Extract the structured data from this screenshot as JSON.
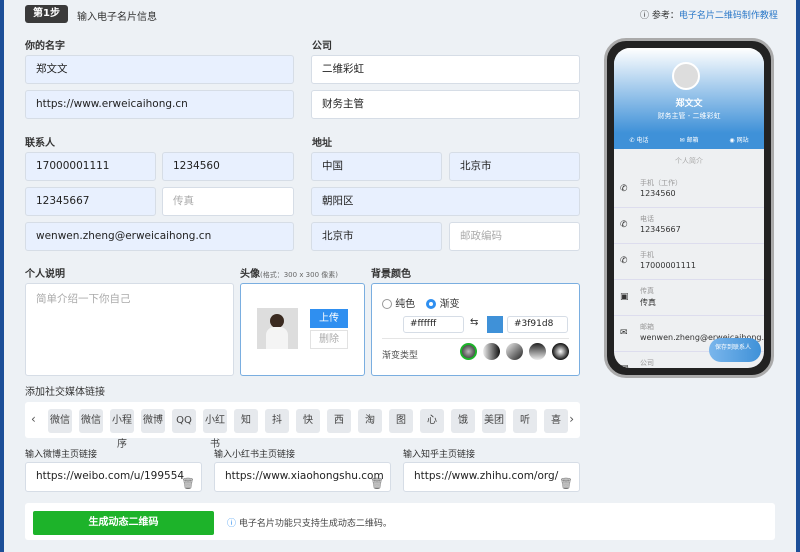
{
  "header": {
    "step": "第1步",
    "title": "输入电子名片信息",
    "ref_label": "参考：",
    "ref_link": "电子名片二维码制作教程"
  },
  "name": {
    "label": "你的名字",
    "value": "郑文文",
    "website": "https://www.erweicaihong.cn"
  },
  "company": {
    "label": "公司",
    "value": "二维彩虹",
    "title": "财务主管"
  },
  "contact": {
    "label": "联系人",
    "mobile": "17000001111",
    "work_phone": "1234560",
    "phone": "12345667",
    "fax_placeholder": "传真",
    "email": "wenwen.zheng@erweicaihong.cn"
  },
  "address": {
    "label": "地址",
    "country": "中国",
    "city": "北京市",
    "district": "朝阳区",
    "province": "北京市",
    "zip_placeholder": "邮政编码"
  },
  "bio": {
    "label": "个人说明",
    "placeholder": "简单介绍一下你自己"
  },
  "avatar": {
    "label": "头像",
    "hint": "(格式：300 x 300 像素)",
    "upload": "上传",
    "delete": "删除"
  },
  "bg": {
    "label": "背景颜色",
    "solid": "纯色",
    "gradient": "渐变",
    "color1": "#ffffff",
    "color2": "#3f91d8",
    "gradient_type_label": "渐变类型"
  },
  "social": {
    "label": "添加社交媒体链接",
    "icons": [
      "微信",
      "微信",
      "小程序",
      "微博",
      "QQ",
      "小红书",
      "知",
      "抖",
      "快",
      "西",
      "淘",
      "图",
      "心",
      "饿",
      "美团",
      "听",
      "喜"
    ]
  },
  "links": [
    {
      "label": "输入微博主页链接",
      "value": "https://weibo.com/u/199554"
    },
    {
      "label": "输入小红书主页链接",
      "value": "https://www.xiaohongshu.com"
    },
    {
      "label": "输入知乎主页链接",
      "value": "https://www.zhihu.com/org/"
    }
  ],
  "footer": {
    "button": "生成动态二维码",
    "info": "电子名片功能只支持生成动态二维码。"
  },
  "preview": {
    "name": "郑文文",
    "subtitle": "财务主管 - 二维彩虹",
    "actions": [
      "电话",
      "邮箱",
      "网站"
    ],
    "bio_title": "个人简介",
    "rows": [
      {
        "t": "手机（工作）",
        "v": "1234560"
      },
      {
        "t": "电话",
        "v": "12345667"
      },
      {
        "t": "手机",
        "v": "17000001111"
      },
      {
        "t": "传真",
        "v": "传真"
      },
      {
        "t": "邮箱",
        "v": "wenwen.zheng@erweicaihong.cn"
      },
      {
        "t": "公司",
        "v": ""
      }
    ],
    "save": "保存到联系人"
  },
  "colors": {
    "accent": "#3f91d8",
    "green": "#1db32a"
  }
}
